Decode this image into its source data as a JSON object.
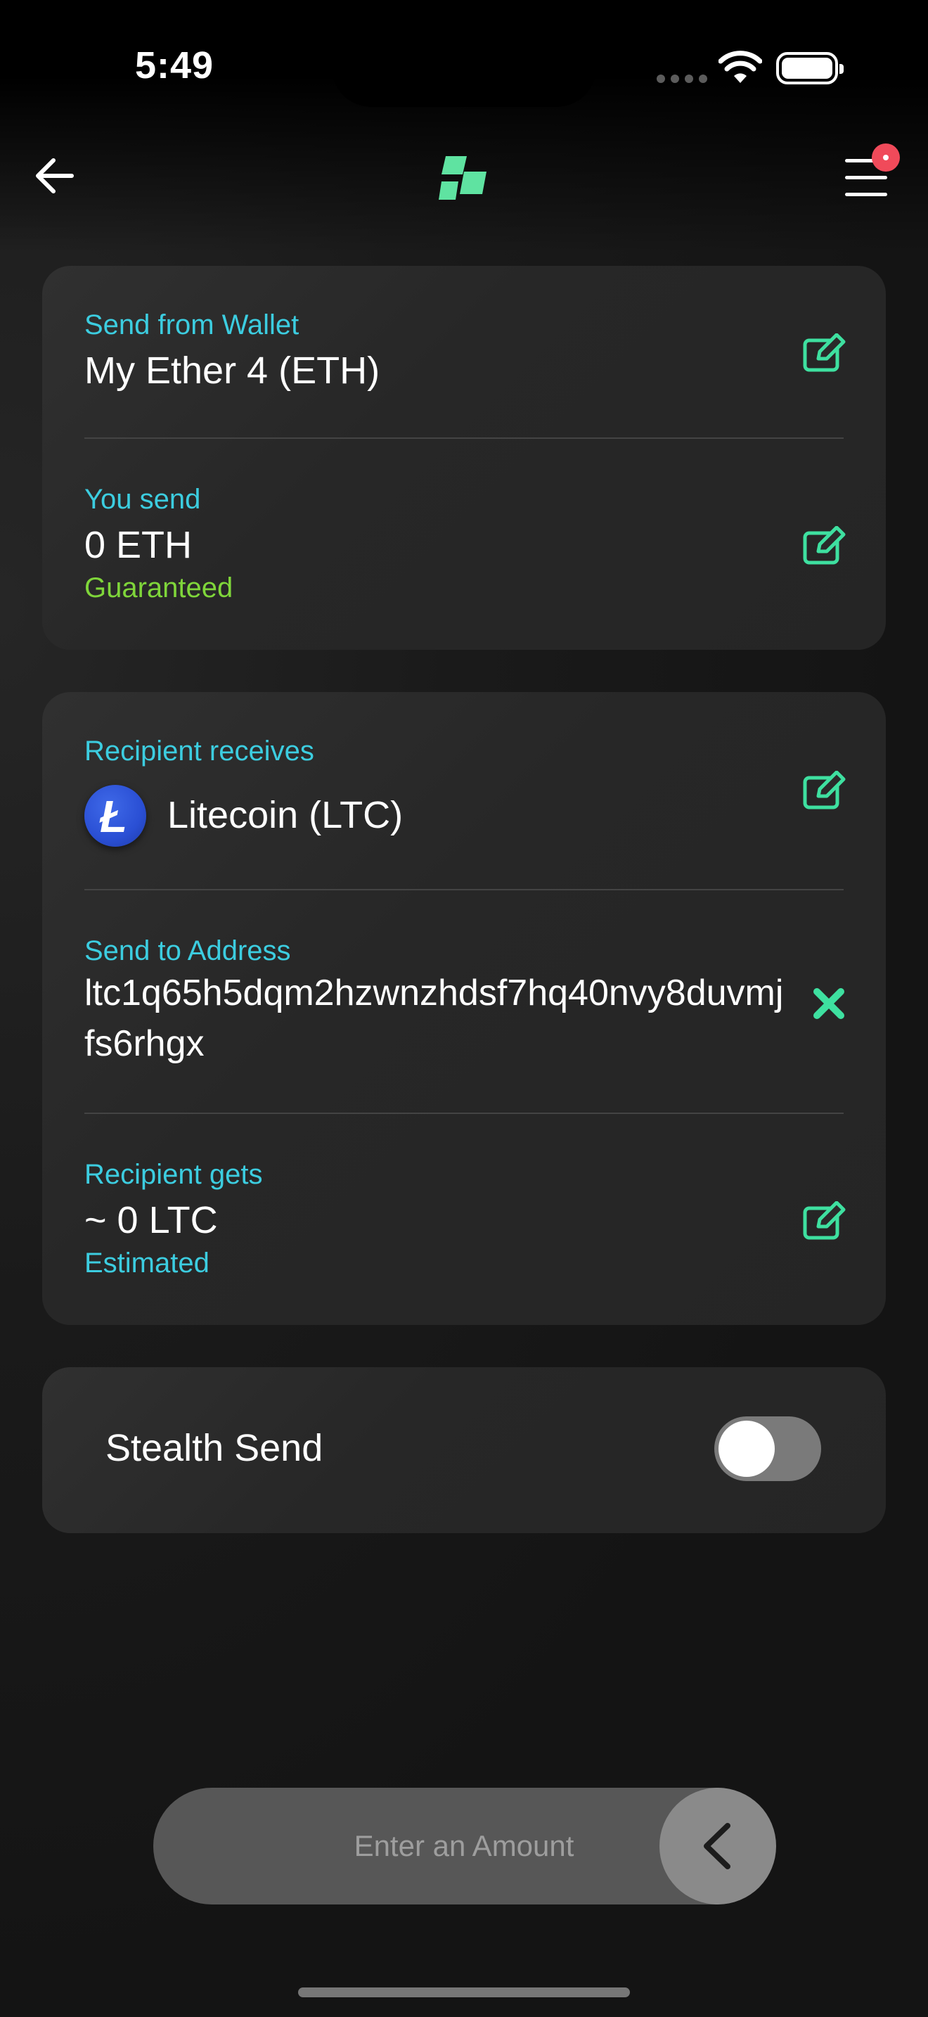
{
  "status_bar": {
    "time": "5:49"
  },
  "nav": {
    "back_icon": "arrow-left-icon",
    "logo_icon": "app-logo-icon",
    "menu_icon": "hamburger-menu-icon",
    "accent": "#5fe3a1"
  },
  "card_send": {
    "wallet_label": "Send from Wallet",
    "wallet_value": "My Ether 4 (ETH)",
    "send_label": "You send",
    "send_value": "0 ETH",
    "send_note": "Guaranteed"
  },
  "card_recipient": {
    "receives_label": "Recipient receives",
    "coin_symbol_glyph": "Ł",
    "coin_name": "Litecoin (LTC)",
    "address_label": "Send to Address",
    "address_value": "ltc1q65h5dqm2hzwnzhdsf7hq40nvy8duvmjfs6rhgx",
    "gets_label": "Recipient gets",
    "gets_value": "~ 0 LTC",
    "gets_note": "Estimated"
  },
  "stealth": {
    "label": "Stealth Send",
    "enabled": false
  },
  "footer": {
    "amount_placeholder": "Enter an Amount"
  },
  "colors": {
    "label_cyan": "#3ccde0",
    "guaranteed_green": "#7fd63a",
    "icon_green": "#3ee0a0",
    "badge_red": "#f04a5a"
  }
}
